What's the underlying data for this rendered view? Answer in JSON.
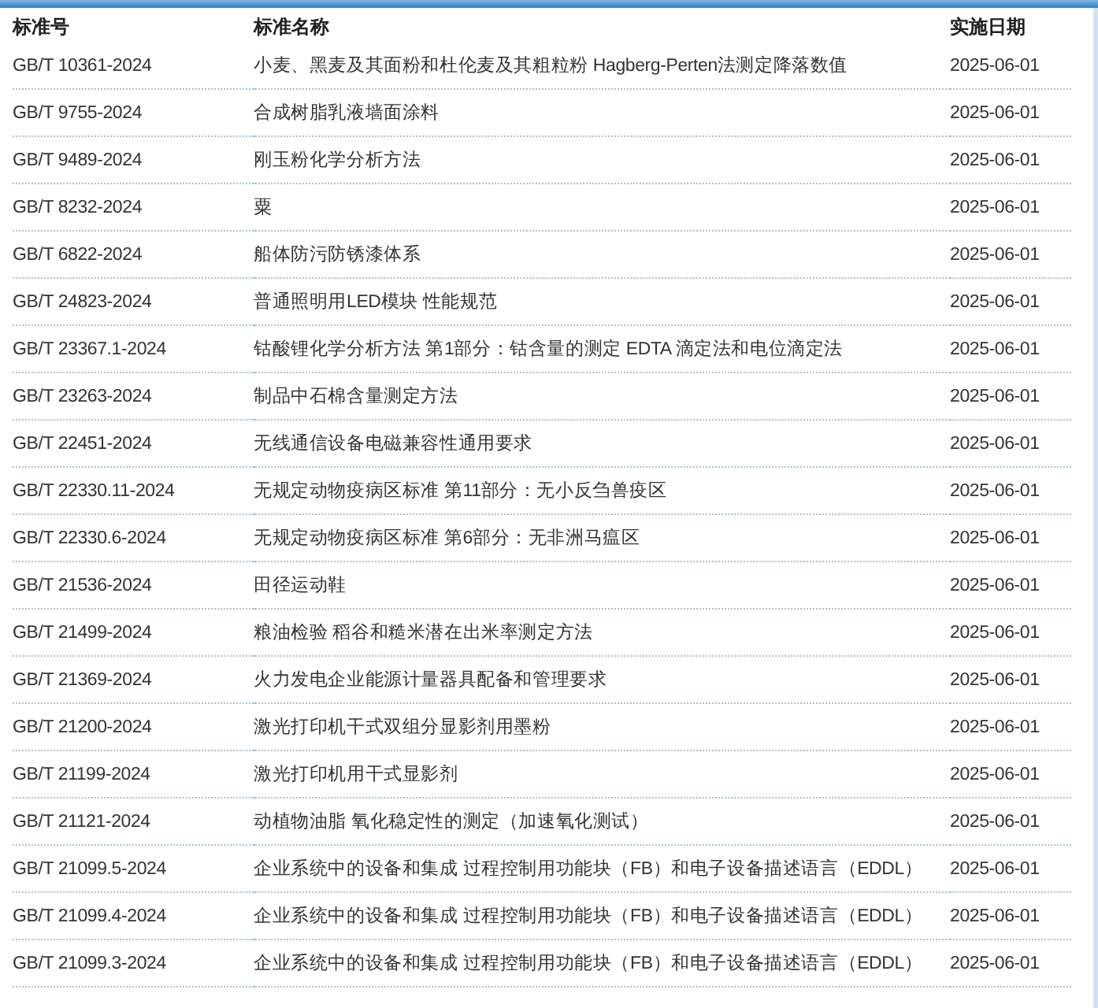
{
  "table": {
    "columns": [
      "标准号",
      "标准名称",
      "实施日期"
    ],
    "rows": [
      [
        "GB/T 10361-2024",
        "小麦、黑麦及其面粉和杜伦麦及其粗粒粉 Hagberg-Perten法测定降落数值",
        "2025-06-01"
      ],
      [
        "GB/T 9755-2024",
        "合成树脂乳液墙面涂料",
        "2025-06-01"
      ],
      [
        "GB/T 9489-2024",
        "刚玉粉化学分析方法",
        "2025-06-01"
      ],
      [
        "GB/T 8232-2024",
        "粟",
        "2025-06-01"
      ],
      [
        "GB/T 6822-2024",
        "船体防污防锈漆体系",
        "2025-06-01"
      ],
      [
        "GB/T 24823-2024",
        "普通照明用LED模块 性能规范",
        "2025-06-01"
      ],
      [
        "GB/T 23367.1-2024",
        "钴酸锂化学分析方法 第1部分：钴含量的测定 EDTA 滴定法和电位滴定法",
        "2025-06-01"
      ],
      [
        "GB/T 23263-2024",
        "制品中石棉含量测定方法",
        "2025-06-01"
      ],
      [
        "GB/T 22451-2024",
        "无线通信设备电磁兼容性通用要求",
        "2025-06-01"
      ],
      [
        "GB/T 22330.11-2024",
        "无规定动物疫病区标准 第11部分：无小反刍兽疫区",
        "2025-06-01"
      ],
      [
        "GB/T 22330.6-2024",
        "无规定动物疫病区标准 第6部分：无非洲马瘟区",
        "2025-06-01"
      ],
      [
        "GB/T 21536-2024",
        "田径运动鞋",
        "2025-06-01"
      ],
      [
        "GB/T 21499-2024",
        "粮油检验 稻谷和糙米潜在出米率测定方法",
        "2025-06-01"
      ],
      [
        "GB/T 21369-2024",
        "火力发电企业能源计量器具配备和管理要求",
        "2025-06-01"
      ],
      [
        "GB/T 21200-2024",
        "激光打印机干式双组分显影剂用墨粉",
        "2025-06-01"
      ],
      [
        "GB/T 21199-2024",
        "激光打印机用干式显影剂",
        "2025-06-01"
      ],
      [
        "GB/T 21121-2024",
        "动植物油脂 氧化稳定性的测定（加速氧化测试）",
        "2025-06-01"
      ],
      [
        "GB/T 21099.5-2024",
        "企业系统中的设备和集成 过程控制用功能块（FB）和电子设备描述语言（EDDL）",
        "2025-06-01"
      ],
      [
        "GB/T 21099.4-2024",
        "企业系统中的设备和集成 过程控制用功能块（FB）和电子设备描述语言（EDDL）",
        "2025-06-01"
      ],
      [
        "GB/T 21099.3-2024",
        "企业系统中的设备和集成 过程控制用功能块（FB）和电子设备描述语言（EDDL）",
        "2025-06-01"
      ]
    ]
  }
}
